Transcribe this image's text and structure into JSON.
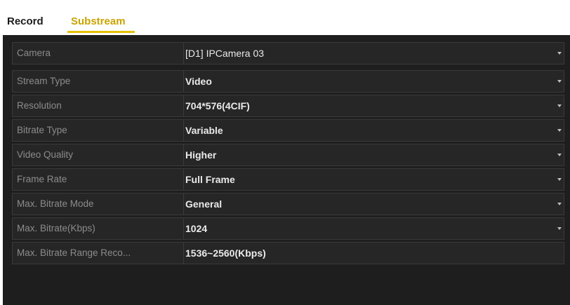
{
  "tabs": {
    "record": "Record",
    "substream": "Substream"
  },
  "camera": {
    "label": "Camera",
    "value": "[D1] IPCamera 03"
  },
  "fields": [
    {
      "label": "Stream Type",
      "value": "Video"
    },
    {
      "label": "Resolution",
      "value": "704*576(4CIF)"
    },
    {
      "label": "Bitrate Type",
      "value": "Variable"
    },
    {
      "label": "Video Quality",
      "value": "Higher"
    },
    {
      "label": "Frame Rate",
      "value": "Full Frame"
    },
    {
      "label": "Max. Bitrate Mode",
      "value": "General"
    },
    {
      "label": "Max. Bitrate(Kbps)",
      "value": "1024"
    },
    {
      "label": "Max. Bitrate Range Reco...",
      "value": "1536~2560(Kbps)"
    }
  ],
  "colors": {
    "accent": "#e5c000",
    "panel": "#1e1e1e",
    "row": "#262626",
    "label_text": "#8c8c8c",
    "value_text": "#eaeaea"
  },
  "icons": {
    "dropdown": "chevron-down-icon"
  }
}
